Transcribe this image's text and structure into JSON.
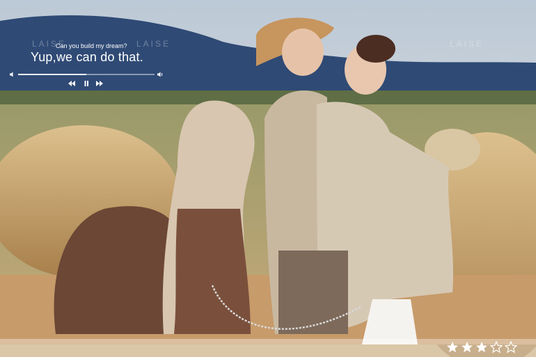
{
  "watermark": {
    "brand": "LAISE"
  },
  "quote": {
    "subtitle": "Can you build my dream?",
    "headline": "Yup,we can do that."
  },
  "player": {
    "progress": 0.5,
    "icons": [
      "volume-low-icon",
      "volume-high-icon",
      "rewind-icon",
      "pause-icon",
      "fast-forward-icon"
    ]
  },
  "rating": {
    "value": 3,
    "max": 5
  },
  "colors": {
    "text": "#ffffff",
    "star_filled": "#ffffff",
    "star_empty_stroke": "#ffffff"
  }
}
